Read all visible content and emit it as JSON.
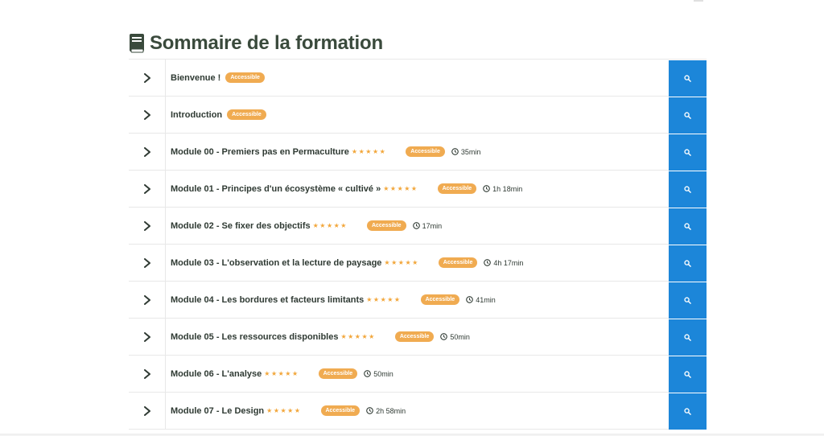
{
  "page": {
    "title": "Sommaire de la formation",
    "title_icon": "book-icon",
    "colors": {
      "accent": "#1c86d9",
      "badge": "#f0ab51",
      "stars": "#f2a63a",
      "heading": "#3a4a3c"
    }
  },
  "rows": [
    {
      "title": "Bienvenue !",
      "stars": "",
      "badge": "Accessible",
      "duration": ""
    },
    {
      "title": "Introduction",
      "stars": "",
      "badge": "Accessible",
      "duration": ""
    },
    {
      "title": "Module 00 - Premiers pas en Permaculture",
      "stars": "★★★★★",
      "badge": "Accessible",
      "duration": "35min"
    },
    {
      "title": "Module 01 - Principes d'un écosystème « cultivé »",
      "stars": "★★★★★",
      "badge": "Accessible",
      "duration": "1h 18min"
    },
    {
      "title": "Module 02 - Se fixer des objectifs",
      "stars": "★★★★★",
      "badge": "Accessible",
      "duration": "17min"
    },
    {
      "title": "Module 03 - L'observation et la lecture de paysage",
      "stars": "★★★★★",
      "badge": "Accessible",
      "duration": "4h 17min"
    },
    {
      "title": "Module 04 - Les bordures et facteurs limitants",
      "stars": "★★★★★",
      "badge": "Accessible",
      "duration": "41min"
    },
    {
      "title": "Module 05 - Les ressources disponibles",
      "stars": "★★★★★",
      "badge": "Accessible",
      "duration": "50min"
    },
    {
      "title": "Module 06 - L'analyse",
      "stars": "★★★★★",
      "badge": "Accessible",
      "duration": "50min"
    },
    {
      "title": "Module 07 - Le Design",
      "stars": "★★★★★",
      "badge": "Accessible",
      "duration": "2h 58min"
    }
  ]
}
